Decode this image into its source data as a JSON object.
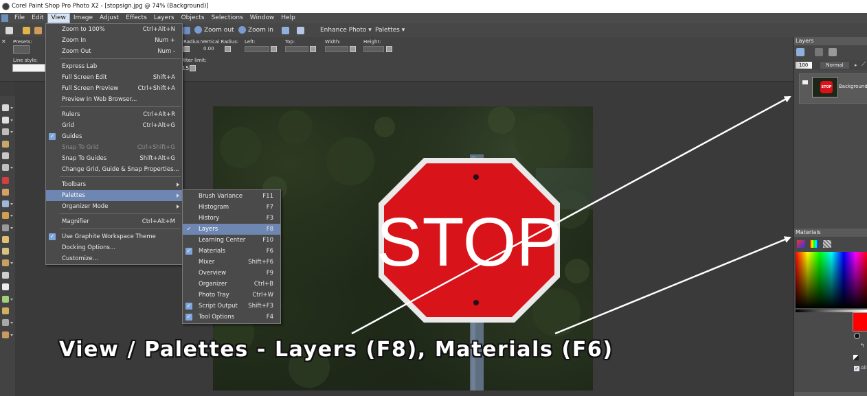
{
  "window": {
    "title": "Corel Paint Shop Pro Photo X2 - [stopsign.jpg @  74% (Background)]"
  },
  "menubar": [
    "File",
    "Edit",
    "View",
    "Image",
    "Adjust",
    "Effects",
    "Layers",
    "Objects",
    "Selections",
    "Window",
    "Help"
  ],
  "toolbar": {
    "zoom_out": "Zoom out",
    "zoom_in": "Zoom in",
    "enhance_photo": "Enhance Photo",
    "palettes": "Palettes"
  },
  "options_bar": {
    "presets_label": "Presets:",
    "line_style_label": "Line style:",
    "radius_label": "Radius:",
    "vertical_radius_label": "Vertical Radius:",
    "vertical_radius_value": "0.00",
    "left_label": "Left:",
    "top_label": "Top:",
    "width_label": "Width:",
    "height_label": "Height:",
    "miter_limit_label": "Miter limit:",
    "miter_limit_value": "15"
  },
  "view_menu": [
    {
      "label": "Zoom to 100%",
      "shortcut": "Ctrl+Alt+N"
    },
    {
      "label": "Zoom In",
      "shortcut": "Num +"
    },
    {
      "label": "Zoom Out",
      "shortcut": "Num -"
    },
    {
      "label": "Express Lab",
      "shortcut": ""
    },
    {
      "label": "Full Screen Edit",
      "shortcut": "Shift+A"
    },
    {
      "label": "Full Screen Preview",
      "shortcut": "Ctrl+Shift+A"
    },
    {
      "label": "Preview In Web Browser...",
      "shortcut": ""
    },
    {
      "label": "Rulers",
      "shortcut": "Ctrl+Alt+R"
    },
    {
      "label": "Grid",
      "shortcut": "Ctrl+Alt+G"
    },
    {
      "label": "Guides",
      "shortcut": ""
    },
    {
      "label": "Snap To Grid",
      "shortcut": "Ctrl+Shift+G"
    },
    {
      "label": "Snap To Guides",
      "shortcut": "Shift+Alt+G"
    },
    {
      "label": "Change Grid, Guide & Snap Properties...",
      "shortcut": ""
    },
    {
      "label": "Toolbars",
      "shortcut": ""
    },
    {
      "label": "Palettes",
      "shortcut": ""
    },
    {
      "label": "Organizer Mode",
      "shortcut": ""
    },
    {
      "label": "Magnifier",
      "shortcut": "Ctrl+Alt+M"
    },
    {
      "label": "Use Graphite Workspace Theme",
      "shortcut": ""
    },
    {
      "label": "Docking Options...",
      "shortcut": ""
    },
    {
      "label": "Customize...",
      "shortcut": ""
    }
  ],
  "palettes_menu": [
    {
      "label": "Brush Variance",
      "shortcut": "F11"
    },
    {
      "label": "Histogram",
      "shortcut": "F7"
    },
    {
      "label": "History",
      "shortcut": "F3"
    },
    {
      "label": "Layers",
      "shortcut": "F8"
    },
    {
      "label": "Learning Center",
      "shortcut": "F10"
    },
    {
      "label": "Materials",
      "shortcut": "F6"
    },
    {
      "label": "Mixer",
      "shortcut": "Shift+F6"
    },
    {
      "label": "Overview",
      "shortcut": "F9"
    },
    {
      "label": "Organizer",
      "shortcut": "Ctrl+B"
    },
    {
      "label": "Photo Tray",
      "shortcut": "Ctrl+W"
    },
    {
      "label": "Script Output",
      "shortcut": "Shift+F3"
    },
    {
      "label": "Tool Options",
      "shortcut": "F4"
    }
  ],
  "layers_panel": {
    "title": "Layers",
    "opacity": "100",
    "blend_mode": "Normal",
    "layer_name": "Background"
  },
  "materials_panel": {
    "title": "Materials",
    "all_tools_label": "All"
  },
  "stop_sign_text": "STOP",
  "thumbnail_text": "STOP",
  "caption": "View / Palettes - Layers (F8), Materials (F6)",
  "colors": {
    "menu_highlight": "#6e86b2",
    "stop_red": "#d8131a",
    "check_blue": "#7ea6dd"
  }
}
